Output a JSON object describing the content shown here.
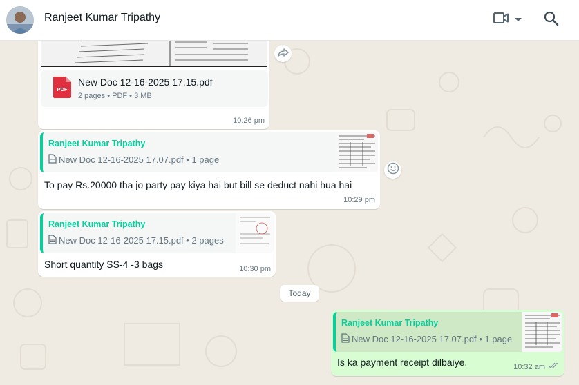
{
  "header": {
    "contact_name": "Ranjeet Kumar Tripathy",
    "video_icon": "video-camera-icon",
    "search_icon": "search-icon"
  },
  "messages": {
    "m1": {
      "file_name": "New Doc 12-16-2025 17.15.pdf",
      "file_meta": "2 pages • PDF • 3 MB",
      "pdf_badge": "PDF",
      "time": "10:26 pm"
    },
    "m2": {
      "quote_sender": "Ranjeet Kumar Tripathy",
      "quote_doc": "New Doc 12-16-2025 17.07.pdf • 1 page",
      "text": "To pay Rs.20000 tha jo party pay kiya hai but bill se deduct nahi hua hai",
      "time": "10:29 pm"
    },
    "m3": {
      "quote_sender": "Ranjeet Kumar Tripathy",
      "quote_doc": "New Doc 12-16-2025 17.15.pdf • 2 pages",
      "text": "Short quantity SS-4 -3 bags",
      "time": "10:30 pm"
    },
    "day_separator": "Today",
    "m4": {
      "quote_sender": "Ranjeet Kumar Tripathy",
      "quote_doc": "New Doc 12-16-2025 17.07.pdf • 1 page",
      "text": "Is ka payment receipt dilbaiye.",
      "time": "10:32 am"
    }
  },
  "colors": {
    "chat_bg": "#efeae2",
    "outgoing_bubble": "#d9fdd3",
    "quote_accent": "#06cf9c",
    "pdf_red": "#e02f3f"
  }
}
